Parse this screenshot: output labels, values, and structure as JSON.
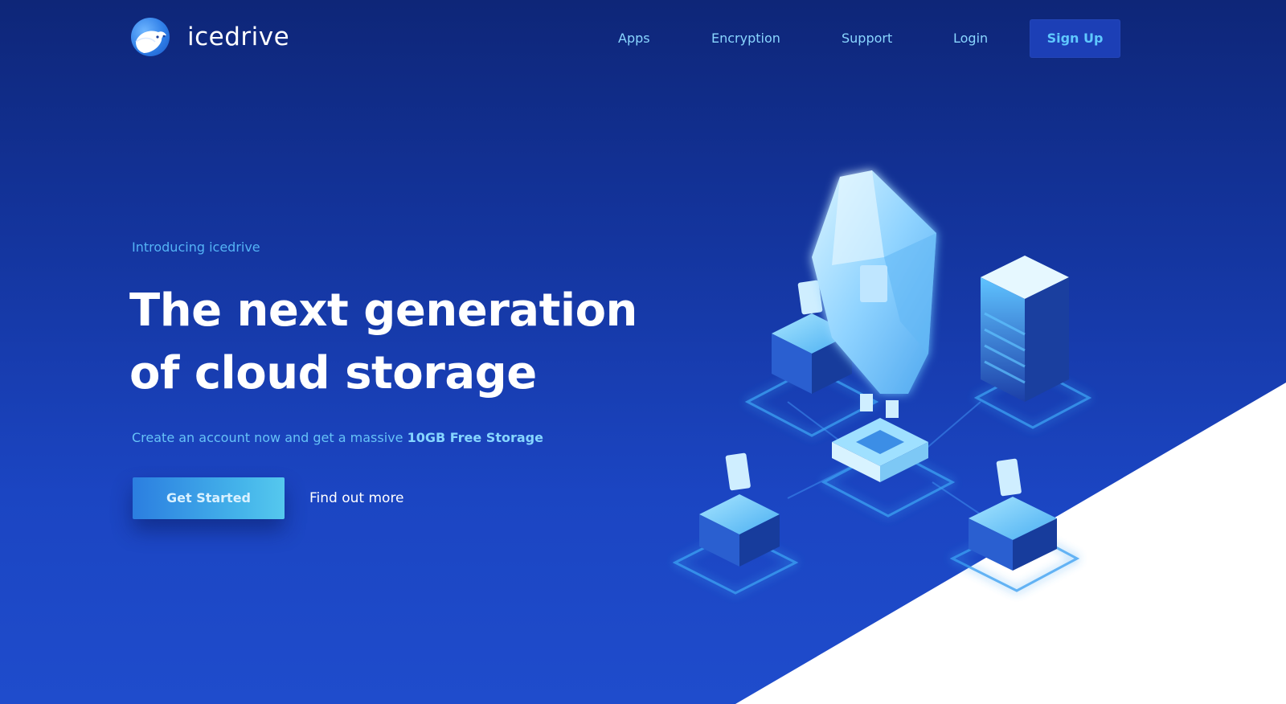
{
  "brand": {
    "name": "icedrive",
    "icon": "polar-bear-logo-icon"
  },
  "nav": {
    "apps": "Apps",
    "encryption": "Encryption",
    "support": "Support",
    "login": "Login",
    "signup": "Sign Up"
  },
  "hero": {
    "intro": "Introducing icedrive",
    "headline_line1": "The next generation",
    "headline_line2": "of cloud storage",
    "subline_prefix": "Create an account now and get a massive ",
    "subline_highlight": "10GB Free Storage",
    "primary_cta": "Get Started",
    "secondary_cta": "Find out more"
  },
  "colors": {
    "background_top": "#0e2678",
    "background_bottom": "#1f4ccc",
    "nav_link": "#8ad6ff",
    "accent": "#54b3f5",
    "signup_bg": "#1c3fb6",
    "cta_gradient_start": "#2b7ee0",
    "cta_gradient_end": "#55c8ee"
  },
  "illustration": {
    "icon": "cloud-storage-ice-crystal-servers-illustration"
  }
}
